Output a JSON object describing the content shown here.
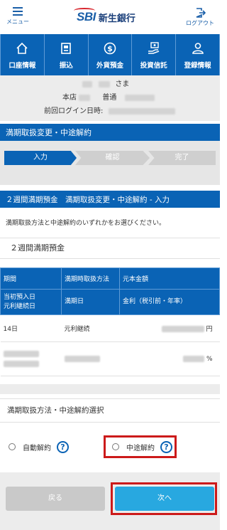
{
  "header": {
    "menu_label": "メニュー",
    "logo_mark": "SBI",
    "bank_name": "新生銀行",
    "logout_label": "ログアウト"
  },
  "nav": [
    {
      "label": "口座情報",
      "icon": "house-icon"
    },
    {
      "label": "振込",
      "icon": "atm-icon"
    },
    {
      "label": "外貨預金",
      "icon": "dollar-icon"
    },
    {
      "label": "投資信託",
      "icon": "hand-coin-icon"
    },
    {
      "label": "登録情報",
      "icon": "person-icon"
    }
  ],
  "customer": {
    "name_suffix": "さま",
    "branch_label": "本店",
    "account_type": "普通",
    "last_login_label": "前回ログイン日時:"
  },
  "section_title": "満期取扱変更・中途解約",
  "steps": [
    "入力",
    "確認",
    "完了"
  ],
  "form_title": "２週間満期預金　満期取扱変更・中途解約 - 入力",
  "instruction": "満期取扱方法と中途解約のいずれかをお選びください。",
  "product_name": "２週間満期預金",
  "table": {
    "header_row1": [
      "期間",
      "満期時取扱方法",
      "元本金額"
    ],
    "header_row2": [
      "当初預入日\n元利継続日",
      "満期日",
      "金利（税引前・年率）"
    ],
    "row1": {
      "period": "14日",
      "method": "元利継続",
      "amount_unit": "円"
    },
    "row2": {
      "rate_unit": "%"
    }
  },
  "selection_title": "満期取扱方法・中途解約選択",
  "options": [
    {
      "label": "自動解約",
      "selected": false
    },
    {
      "label": "中途解約",
      "selected": false
    }
  ],
  "buttons": {
    "back": "戻る",
    "next": "次へ"
  },
  "colors": {
    "primary": "#0a63b5",
    "next_button": "#28a8e0",
    "highlight": "#cc1a1a"
  }
}
